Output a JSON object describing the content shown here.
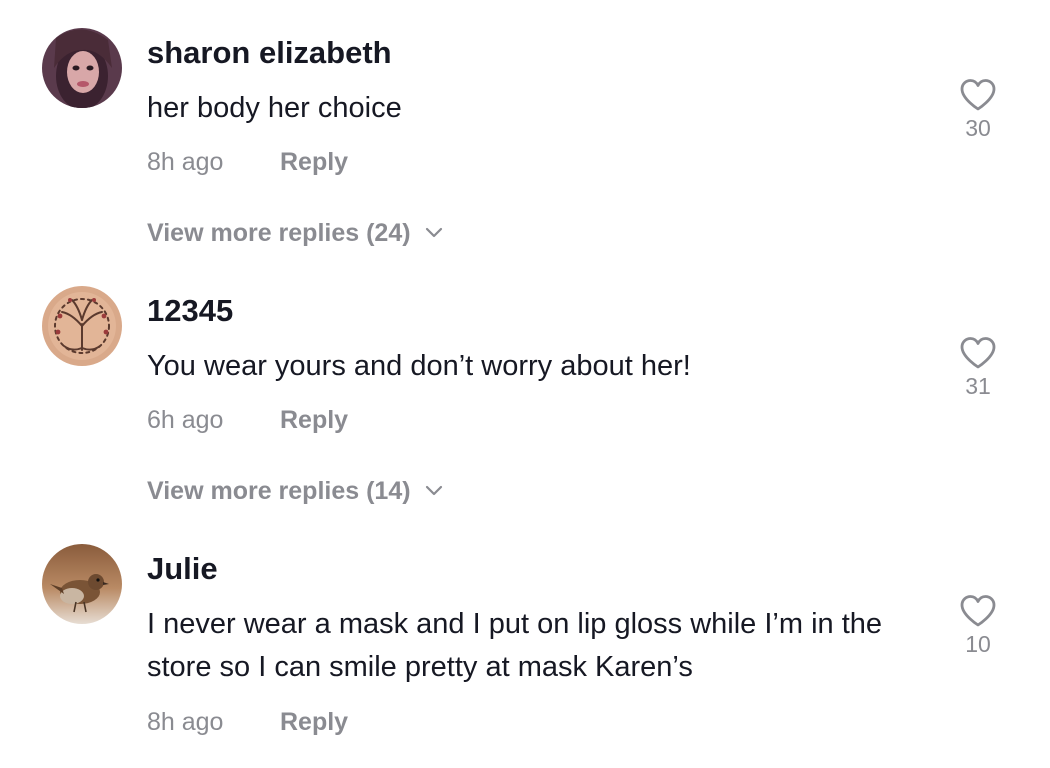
{
  "comments": [
    {
      "username": "sharon elizabeth",
      "text": "her body her choice",
      "time": "8h ago",
      "reply_label": "Reply",
      "likes": "30",
      "view_more": "View more replies (24)"
    },
    {
      "username": "12345",
      "text": "You wear yours and don’t worry about her!",
      "time": "6h ago",
      "reply_label": "Reply",
      "likes": "31",
      "view_more": "View more replies (14)"
    },
    {
      "username": "Julie",
      "text": "I never wear a mask and I put on lip gloss while I’m in the store so I can smile pretty at mask Karen’s",
      "time": "8h ago",
      "reply_label": "Reply",
      "likes": "10"
    }
  ],
  "icons": {
    "like": "heart-outline-icon",
    "expand": "chevron-down-icon"
  },
  "colors": {
    "primary_text": "#161823",
    "secondary_text": "#8a8b91"
  }
}
